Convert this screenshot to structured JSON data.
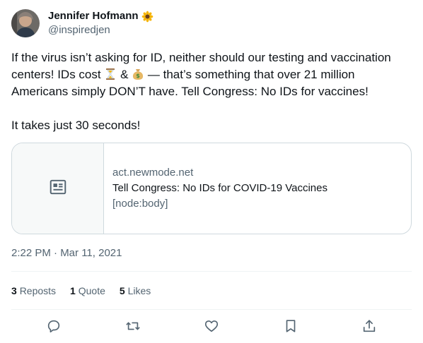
{
  "author": {
    "display_name": "Jennifer Hofmann",
    "handle": "@inspiredjen",
    "name_emoji": "sunflower-icon"
  },
  "tweet": {
    "line1": "If the virus isn’t asking for ID, neither should our testing and vaccination",
    "line2_a": "centers! IDs cost",
    "line2_b": "&",
    "line2_c": "— that’s something that over 21 million",
    "line3": "Americans simply DON’T have. Tell Congress: No IDs for vaccines!",
    "line4": "It takes just 30 seconds!",
    "emoji_1": "hourglass-icon",
    "emoji_2": "money-bag-icon"
  },
  "card": {
    "domain": "act.newmode.net",
    "title": "Tell Congress: No IDs for COVID-19 Vaccines",
    "description": "[node:body]",
    "thumb_icon": "article-icon"
  },
  "timestamp": "2:22 PM · Mar 11, 2021",
  "stats": {
    "reposts_count": "3",
    "reposts_label": "Reposts",
    "quotes_count": "1",
    "quotes_label": "Quote",
    "likes_count": "5",
    "likes_label": "Likes"
  },
  "actions": [
    "reply-icon",
    "repost-icon",
    "like-icon",
    "bookmark-icon",
    "share-icon"
  ],
  "colors": {
    "text": "#0f1419",
    "secondary": "#536471",
    "border": "#cfd9de"
  }
}
